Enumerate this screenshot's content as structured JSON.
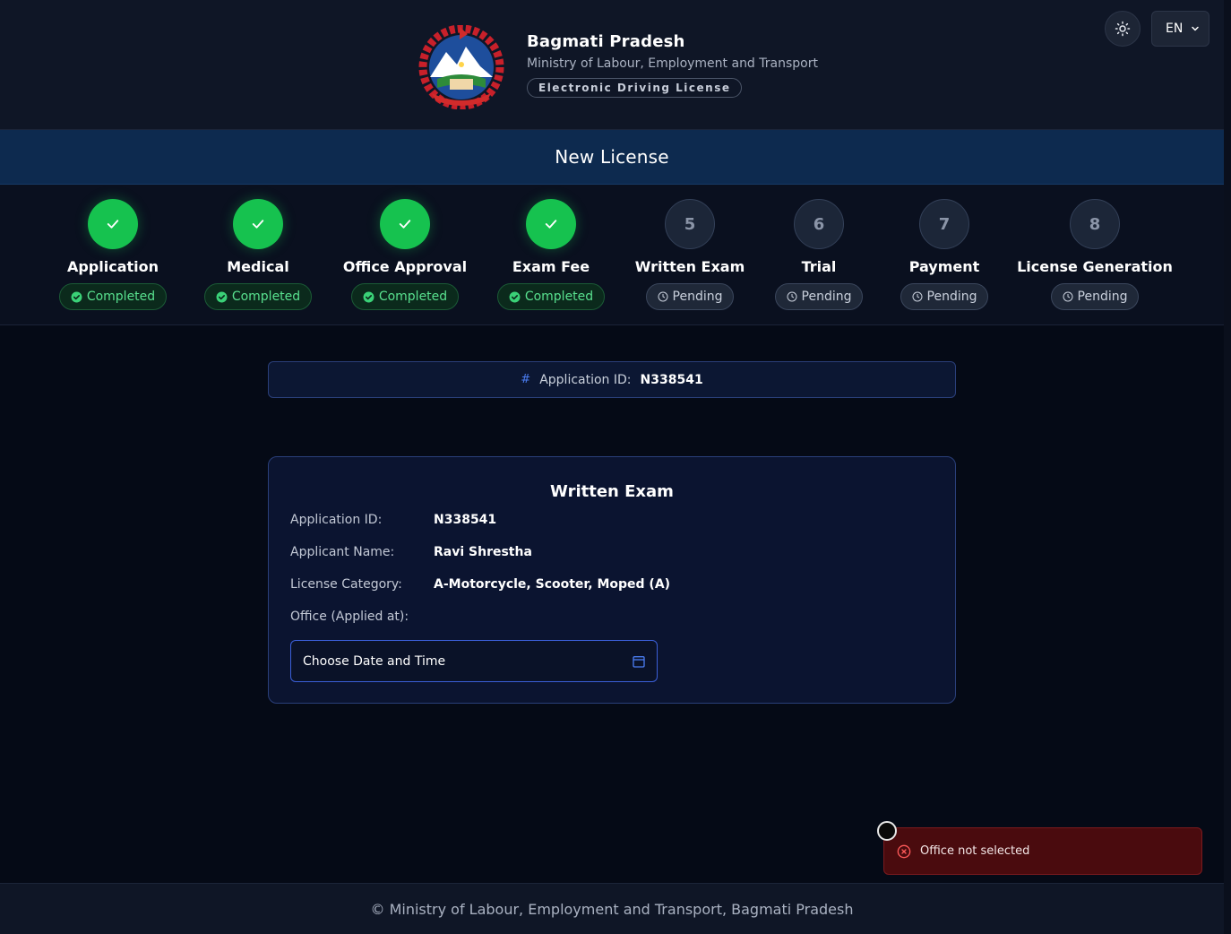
{
  "header": {
    "title": "Bagmati Pradesh",
    "subtitle": "Ministry of Labour, Employment and Transport",
    "pill": "Electronic Driving License",
    "language": "EN",
    "emblem_icon": "nepal-emblem-icon",
    "theme_icon": "sun-icon"
  },
  "title_bar": {
    "title": "New License"
  },
  "steps": [
    {
      "number": "1",
      "label": "Application",
      "status": "Completed",
      "done": true
    },
    {
      "number": "2",
      "label": "Medical",
      "status": "Completed",
      "done": true
    },
    {
      "number": "3",
      "label": "Office Approval",
      "status": "Completed",
      "done": true
    },
    {
      "number": "4",
      "label": "Exam Fee",
      "status": "Completed",
      "done": true
    },
    {
      "number": "5",
      "label": "Written Exam",
      "status": "Pending",
      "done": false
    },
    {
      "number": "6",
      "label": "Trial",
      "status": "Pending",
      "done": false
    },
    {
      "number": "7",
      "label": "Payment",
      "status": "Pending",
      "done": false
    },
    {
      "number": "8",
      "label": "License Generation",
      "status": "Pending",
      "done": false
    }
  ],
  "application_bar": {
    "hash": "#",
    "label": "Application ID:",
    "value": "N338541"
  },
  "exam_card": {
    "title": "Written Exam",
    "fields": [
      {
        "key": "Application ID:",
        "value": "N338541"
      },
      {
        "key": "Applicant Name:",
        "value": "Ravi Shrestha"
      },
      {
        "key": "License Category:",
        "value": "A-Motorcycle, Scooter, Moped (A)"
      },
      {
        "key": "Office (Applied at):",
        "value": ""
      }
    ],
    "date_placeholder": "Choose Date and Time"
  },
  "toast": {
    "message": "Office not selected"
  },
  "footer": {
    "text": "© Ministry of Labour, Employment and Transport, Bagmati Pradesh"
  },
  "colors": {
    "success": "#16c24f",
    "accent": "#3b5fd8",
    "error_bg": "#4a0b0e",
    "header_bg": "#0f1626",
    "title_bar_bg": "#0d2a4f"
  }
}
